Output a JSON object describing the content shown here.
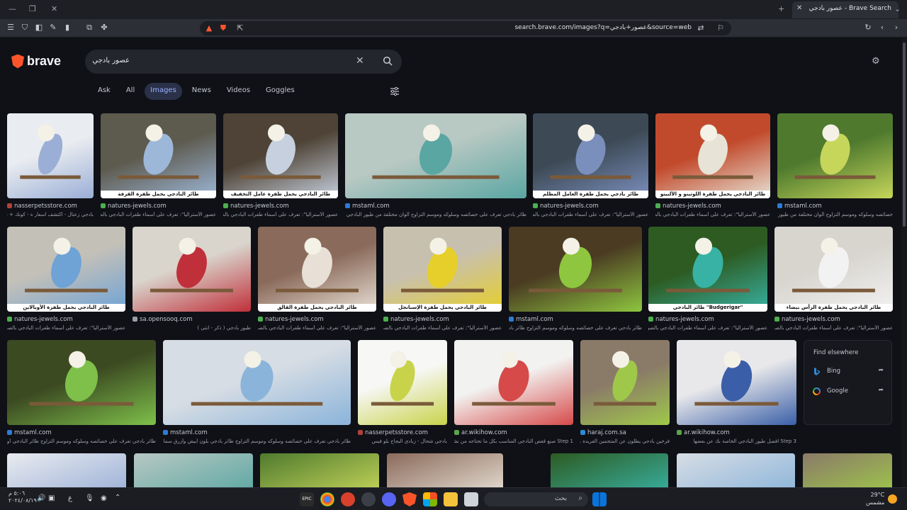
{
  "browser": {
    "tab_title": "Brave Search - عصور بادجي",
    "url": "search.brave.com/images?q=عصور+بادجي&source=web"
  },
  "brand": {
    "name": "brave"
  },
  "search": {
    "query": "عصور بادجي"
  },
  "nav": {
    "tabs": [
      {
        "label": "Ask"
      },
      {
        "label": "All"
      },
      {
        "label": "Images"
      },
      {
        "label": "News"
      },
      {
        "label": "Videos"
      },
      {
        "label": "Goggles"
      }
    ],
    "active": "Images"
  },
  "results": [
    {
      "source": "nasserpetsstore.com",
      "desc": "بادجي زعتال - اكتشف اسعار ة - كونك + ديل كريمات",
      "caption": "",
      "fav": "#b1413a"
    },
    {
      "source": "natures-jewels.com",
      "desc": "عصور الأستراليا\": تعرف على أسماء طفرات البادجي بالصور",
      "caption": "طائر البادجي يحمل طفرة القرفة",
      "fav": "#4caf50"
    },
    {
      "source": "natures-jewels.com",
      "desc": "عصور الأستراليا\": تعرف على أسماء طفرات البادجي بالصور",
      "caption": "طائر البادجي يحمل طفرة عامل التخفيف",
      "fav": "#4caf50"
    },
    {
      "source": "mstaml.com",
      "desc": "طائر بادجي تعرف على خصائصه وسلوكه وموسم التزاوج ألوان مختلفة من طيور البادجي",
      "caption": "",
      "fav": "#2e7bd6"
    },
    {
      "source": "natures-jewels.com",
      "desc": "عصور الأستراليا\": تعرف على أسماء طفرات البادجي بالصور",
      "caption": "طائر بادجي يحمل طفرة العامل المظلم",
      "fav": "#4caf50"
    },
    {
      "source": "natures-jewels.com",
      "desc": "عصور الأستراليا\": تعرف على أسماء طفرات البادجي بالصور",
      "caption": "طائر البادجي يحمل طفرة اللوتينو و الألبينو",
      "fav": "#4caf50"
    },
    {
      "source": "mstaml.com",
      "desc": "خصائصه وسلوكه وموسم التزاوج ألوان مختلفة من طيور البادجي",
      "caption": "",
      "fav": "#2e7bd6"
    },
    {
      "source": "natures-jewels.com",
      "desc": "عصور الأستراليا\": تعرف على أسماء طفرات البادجي بالصور",
      "caption": "طائر البادجي يحمل طفرة الأوبالاين",
      "fav": "#4caf50"
    },
    {
      "source": "sa.opensooq.com",
      "desc": "طيور بادجي ( ذكر - انثى )",
      "caption": "",
      "fav": "#9aa0a6"
    },
    {
      "source": "natures-jewels.com",
      "desc": "عصور الأستراليا\": تعرف على أسماء طفرات البادجي بالصور",
      "caption": "طائر البادجي يحمل طفرة القالق",
      "fav": "#4caf50"
    },
    {
      "source": "natures-jewels.com",
      "desc": "عصور الأستراليا\": تعرف على أسماء طفرات البادجي بالصور",
      "caption": "طائر البادجي يحمل طفرة الإسبانجل",
      "fav": "#4caf50"
    },
    {
      "source": "mstaml.com",
      "desc": "طائر بادجي تعرف على خصائصه وسلوكه وموسم التزاوج طائر بادجي أستراليا بشكله الطبيعي",
      "caption": "",
      "fav": "#2e7bd6"
    },
    {
      "source": "natures-jewels.com",
      "desc": "عصور الأستراليا\": تعرف على أسماء طفرات البادجي بالصور",
      "caption": "\"Budgerigar\" طائر البادجي",
      "fav": "#4caf50"
    },
    {
      "source": "natures-jewels.com",
      "desc": "عصور الأستراليا\": تعرف على أسماء طفرات البادجي بالصور",
      "caption": "طائر البادجي يحمل طفرة الرأس بيضاء",
      "fav": "#4caf50"
    },
    {
      "source": "mstaml.com",
      "desc": "طائر بادجي تعرف على خصائصه وسلوكه وموسم التزاوج طائر البادجي أو طيور الحب",
      "caption": "",
      "fav": "#2e7bd6"
    },
    {
      "source": "mstaml.com",
      "desc": "طائر بادجي تعرف على خصائصه وسلوكه وموسم التزاوج طائر بادجي بلون أبيض وأزرق سماوي",
      "caption": "",
      "fav": "#2e7bd6"
    },
    {
      "source": "nasserpetsstore.com",
      "desc": "بادجي شحال - زبادي البجاح بلو فيس",
      "caption": "",
      "fav": "#b1413a"
    },
    {
      "source": "ar.wikihow.com",
      "desc": "Step 1 صنع قفص البادجي المناسب بكل ما تحتاجه من نشاط شيء",
      "caption": "",
      "fav": "#5aa64a"
    },
    {
      "source": "haraj.com.sa",
      "desc": "فرخين بادجي يطلون عن المتجمين الفريدة و الهدد",
      "caption": "",
      "fav": "#2d8cd6"
    },
    {
      "source": "ar.wikihow.com",
      "desc": "Step 3 افصل طيور البادجي الخاصة بك عن بعضها",
      "caption": "",
      "fav": "#5aa64a"
    }
  ],
  "find_elsewhere": {
    "heading": "Find elsewhere",
    "engines": [
      {
        "label": "Bing"
      },
      {
        "label": "Google"
      }
    ]
  },
  "taskbar": {
    "search_placeholder": "بحث",
    "weather_temp": "29°C",
    "weather_desc": "مشمس",
    "time": "٥:٠٦ م",
    "date": "٢٠٢٤/٠٨/١٩",
    "lang": "ع"
  }
}
